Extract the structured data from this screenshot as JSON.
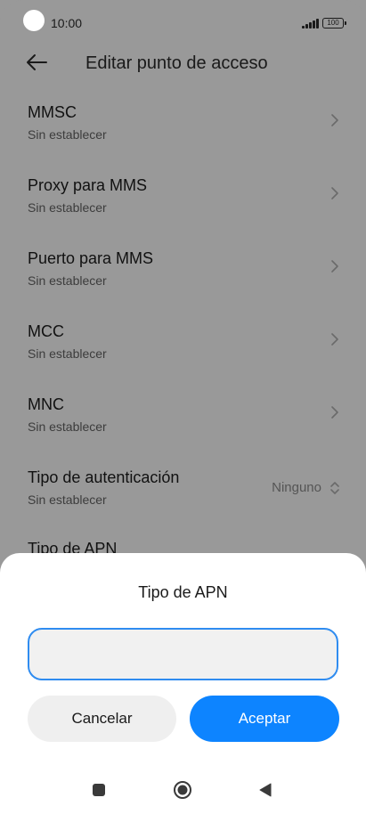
{
  "status_bar": {
    "time": "10:00",
    "battery": "100"
  },
  "header": {
    "title": "Editar punto de acceso"
  },
  "items": [
    {
      "title": "MMSC",
      "subtitle": "Sin establecer"
    },
    {
      "title": "Proxy para MMS",
      "subtitle": "Sin establecer"
    },
    {
      "title": "Puerto para MMS",
      "subtitle": "Sin establecer"
    },
    {
      "title": "MCC",
      "subtitle": "Sin establecer"
    },
    {
      "title": "MNC",
      "subtitle": "Sin establecer"
    },
    {
      "title": "Tipo de autenticación",
      "subtitle": "Sin establecer",
      "value": "Ninguno"
    },
    {
      "title": "Tipo de APN"
    }
  ],
  "dialog": {
    "title": "Tipo de APN",
    "input_value": "",
    "cancel_label": "Cancelar",
    "accept_label": "Aceptar"
  },
  "icons": {
    "back": "arrow-left-icon",
    "chevron": "chevron-right-icon",
    "updown": "chevron-updown-icon"
  },
  "colors": {
    "accent": "#0d84ff",
    "input_border": "#2f8cf0",
    "dim_background": "#999999"
  }
}
